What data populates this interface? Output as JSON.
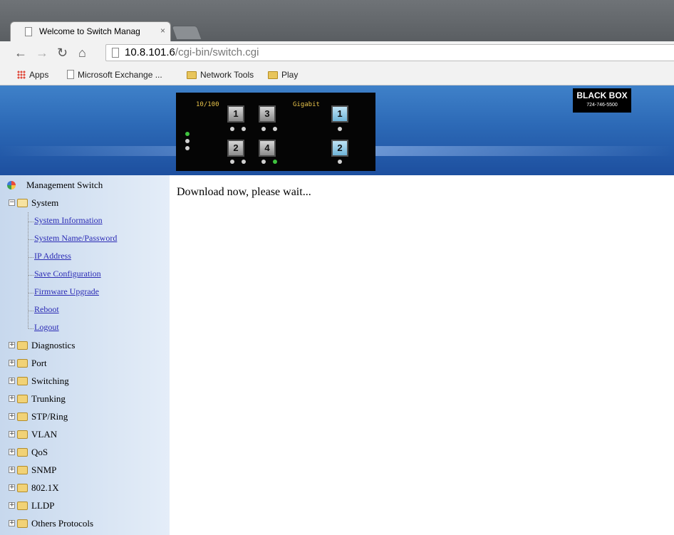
{
  "browser": {
    "tab_title": "Welcome to Switch Manag",
    "tab_close": "×",
    "url_host": "10.8.101.6",
    "url_path": "/cgi-bin/switch.cgi",
    "bookmarks": [
      {
        "label": "Apps",
        "icon": "apps-grid-icon"
      },
      {
        "label": "Microsoft Exchange ...",
        "icon": "page-icon"
      },
      {
        "label": "Network Tools",
        "icon": "folder-icon"
      },
      {
        "label": "Play",
        "icon": "folder-icon"
      }
    ]
  },
  "panel": {
    "label_fast": "10/100",
    "label_gig": "Gigabit",
    "ports": [
      "1",
      "3",
      "2",
      "4"
    ],
    "gig_ports": [
      "1",
      "2"
    ]
  },
  "logo": {
    "name": "BLACK BOX",
    "phone": "724-746-5500"
  },
  "sidebar": {
    "root": "Management Switch",
    "system": "System",
    "system_items": [
      "System Information",
      "System Name/Password",
      "IP Address",
      "Save Configuration",
      "Firmware Upgrade",
      "Reboot",
      "Logout"
    ],
    "groups": [
      "Diagnostics",
      "Port",
      "Switching",
      "Trunking",
      "STP/Ring",
      "VLAN",
      "QoS",
      "SNMP",
      "802.1X",
      "LLDP",
      "Others Protocols"
    ]
  },
  "main": {
    "message": "Download now, please wait..."
  }
}
